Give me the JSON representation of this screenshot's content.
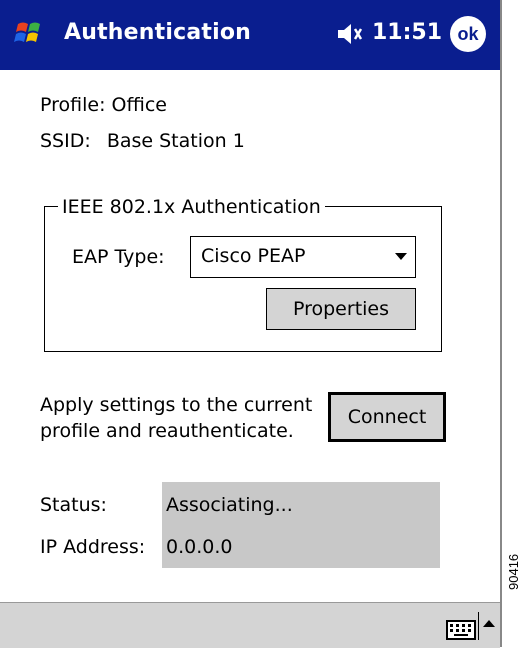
{
  "titlebar": {
    "title": "Authentication",
    "time": "11:51",
    "ok_label": "ok"
  },
  "profile": {
    "profile_label": "Profile:",
    "profile_value": "Office",
    "ssid_label": "SSID:",
    "ssid_value": "Base Station 1"
  },
  "group": {
    "title": "IEEE 802.1x Authentication",
    "eap_label": "EAP Type:",
    "eap_value": "Cisco PEAP",
    "properties_label": "Properties"
  },
  "connect": {
    "text_line1": "Apply settings to the current",
    "text_line2": "profile and reauthenticate.",
    "button_label": "Connect"
  },
  "status": {
    "status_label": "Status:",
    "status_value": "Associating...",
    "ip_label": "IP Address:",
    "ip_value": "0.0.0.0"
  },
  "figure_number": "90416",
  "colors": {
    "titlebar": "#0a1e8f",
    "status_box": "#c8c8c8",
    "button": "#d4d4d4"
  }
}
